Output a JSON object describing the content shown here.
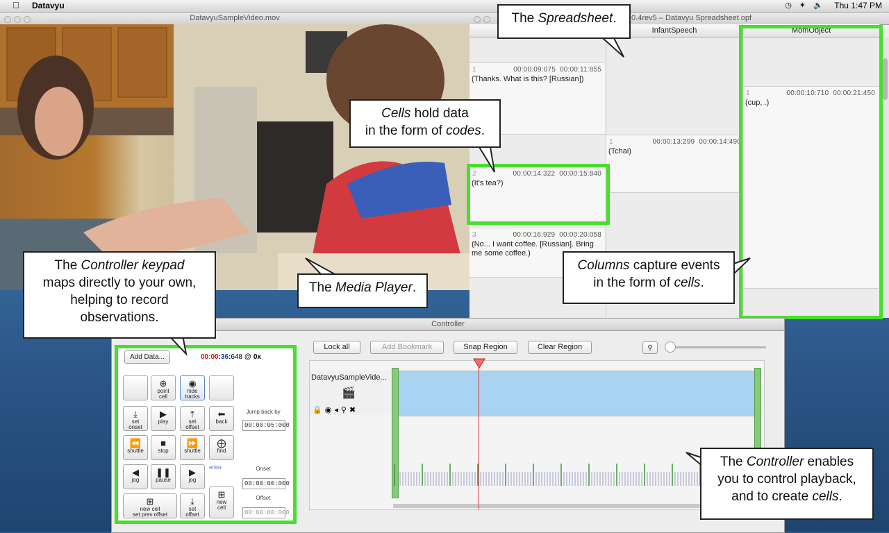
{
  "menubar": {
    "app_name": "Datavyu",
    "clock": "Thu 1:47 PM"
  },
  "video_window": {
    "title": "DatavyuSampleVideo.mov"
  },
  "spreadsheet": {
    "title": ".0.4rev5 – Datavyu Spreadsheet.opf",
    "columns": [
      "",
      "InfantSpeech",
      "MomObject"
    ],
    "cells": [
      {
        "ord": "1",
        "onset": "00:00:09:075",
        "offset": "00:00:11:855",
        "value": "(Thanks. What is this? [Russian])"
      },
      {
        "ord": "2",
        "onset": "00:00:14:322",
        "offset": "00:00:15:840",
        "value": "(It's tea?)"
      },
      {
        "ord": "3",
        "onset": "00:00:16:929",
        "offset": "00:00:20:058",
        "value": "(No... I want coffee. [Russian]. Bring me some coffee.)"
      },
      {
        "ord": "1",
        "onset": "00:00:13:299",
        "offset": "00:00:14:490",
        "value": "(Tchai)"
      },
      {
        "ord": "1",
        "onset": "00:00:10:710",
        "offset": "00:00:21:450",
        "value": "(cup, .)"
      }
    ]
  },
  "controller": {
    "title": "Controller",
    "add_data": "Add Data...",
    "clock": {
      "h": "00",
      "m": "00",
      "s": "36",
      "ms": "648",
      "rate": "0x",
      "at": "@"
    },
    "toolbar": {
      "lock": "Lock all",
      "bookmark": "Add Bookmark",
      "snap": "Snap Region",
      "clear": "Clear Region"
    },
    "track_name": "DatavyuSampleVide...",
    "jump_back_label": "Jump back by",
    "jump_back_value": "00:00:05:000",
    "onset_label": "Onset",
    "onset_value": "00:00:00:000",
    "offset_label": "Offset",
    "offset_value": "00:00:00:000",
    "enter_label": "enter",
    "keys": {
      "point": "point",
      "cell": "cell",
      "hide": "hide",
      "tracks": "tracks",
      "set_onset_a": "set",
      "set_onset_b": "onset",
      "play": "play",
      "set_offset_a": "set",
      "set_offset_b": "offset",
      "back": "back",
      "shuttle_l": "shuttle",
      "stop": "stop",
      "shuttle_r": "shuttle",
      "find": "find",
      "jog_l": "jog",
      "pause": "pause",
      "jog_r": "jog",
      "new_cell_a": "new cell",
      "new_cell_b": "set prev offset",
      "set2_a": "set",
      "set2_b": "offset",
      "new_a": "new",
      "new_b": "cell"
    }
  },
  "callouts": {
    "spreadsheet": {
      "a": "The ",
      "em": "Spreadsheet",
      "b": "."
    },
    "cells": {
      "em1": "Cells",
      "a": " hold data",
      "b": "in the form of ",
      "em2": "codes",
      "c": "."
    },
    "keypad": {
      "a": "The ",
      "em": "Controller keypad",
      "b": "maps directly to your own,",
      "c": "helping to record",
      "d": "observations."
    },
    "media": {
      "a": "The ",
      "em": "Media Player",
      "b": "."
    },
    "columns": {
      "em1": "Columns",
      "a": " capture events",
      "b": "in the form of ",
      "em2": "cells",
      "c": "."
    },
    "controller": {
      "a": "The ",
      "em": "Controller",
      "b": " enables",
      "c": "you to control playback,",
      "d": "and to create ",
      "em2": "cells",
      "e": "."
    }
  },
  "colors": {
    "highlight": "#46e02c",
    "timeline_fill": "#aad4f0",
    "playhead": "#e03030"
  }
}
